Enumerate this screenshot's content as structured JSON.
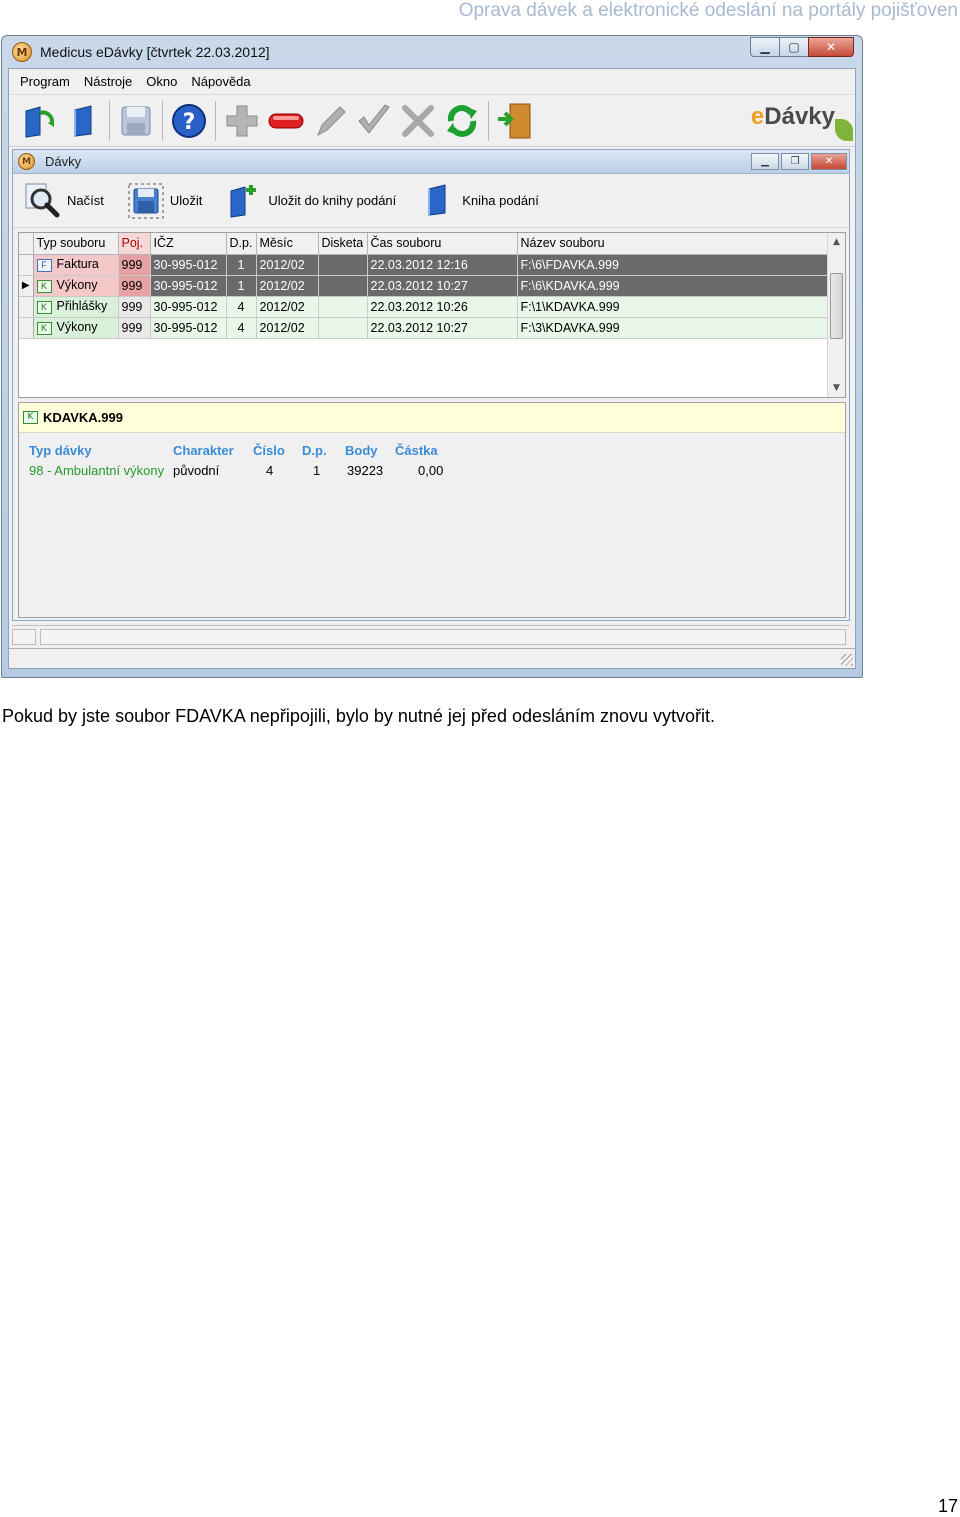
{
  "doc_header": "Oprava dávek a elektronické odeslání na portály pojišťoven",
  "window": {
    "title": "Medicus eDávky  [čtvrtek 22.03.2012]",
    "icon": "medicus-app-icon",
    "buttons": [
      "minimize",
      "maximize",
      "close"
    ]
  },
  "menu": [
    "Program",
    "Nástroje",
    "Okno",
    "Nápověda"
  ],
  "toolbar": {
    "icons": [
      "load-batch-icon",
      "book-icon",
      "save-disk-icon",
      "help-icon",
      "add-icon",
      "remove-icon",
      "edit-icon",
      "confirm-icon",
      "cancel-icon",
      "refresh-icon",
      "exit-door-icon"
    ],
    "brand": {
      "prefix": "e",
      "rest": "Dávky"
    }
  },
  "child_window": {
    "title": "Dávky",
    "actions": [
      {
        "label": "Načíst",
        "icon": "magnifier-icon"
      },
      {
        "label": "Uložit",
        "icon": "save-disk-icon"
      },
      {
        "label": "Uložit do knihy podání",
        "icon": "book-add-icon"
      },
      {
        "label": "Kniha podání",
        "icon": "book-icon"
      }
    ]
  },
  "grid": {
    "columns": [
      "Typ souboru",
      "Poj.",
      "IČZ",
      "D.p.",
      "Měsíc",
      "Disketa",
      "Čas souboru",
      "Název souboru"
    ],
    "rows": [
      {
        "badge": "F",
        "typ": "Faktura",
        "poj": "999",
        "icz": "30-995-012",
        "dp": "1",
        "mesic": "2012/02",
        "disketa": "",
        "cas": "22.03.2012 12:16",
        "nazev": "F:\\6\\FDAVKA.999",
        "style": "dark",
        "current": false
      },
      {
        "badge": "K",
        "typ": "Výkony",
        "poj": "999",
        "icz": "30-995-012",
        "dp": "1",
        "mesic": "2012/02",
        "disketa": "",
        "cas": "22.03.2012 10:27",
        "nazev": "F:\\6\\KDAVKA.999",
        "style": "dark",
        "current": true
      },
      {
        "badge": "K",
        "typ": "Přihlášky",
        "poj": "999",
        "icz": "30-995-012",
        "dp": "4",
        "mesic": "2012/02",
        "disketa": "",
        "cas": "22.03.2012 10:26",
        "nazev": "F:\\1\\KDAVKA.999",
        "style": "light",
        "current": false
      },
      {
        "badge": "K",
        "typ": "Výkony",
        "poj": "999",
        "icz": "30-995-012",
        "dp": "4",
        "mesic": "2012/02",
        "disketa": "",
        "cas": "22.03.2012 10:27",
        "nazev": "F:\\3\\KDAVKA.999",
        "style": "light",
        "current": false
      }
    ]
  },
  "detail": {
    "badge": "K",
    "name": "KDAVKA.999",
    "labels": [
      "Typ dávky",
      "Charakter",
      "Číslo",
      "D.p.",
      "Body",
      "Částka"
    ],
    "values": [
      "98 - Ambulantní výkony",
      "původní",
      "4",
      "1",
      "39223",
      "0,00"
    ]
  },
  "caption": "Pokud by jste soubor FDAVKA nepřipojili, bylo by nutné jej před odesláním znovu vytvořit.",
  "page_number": "17"
}
